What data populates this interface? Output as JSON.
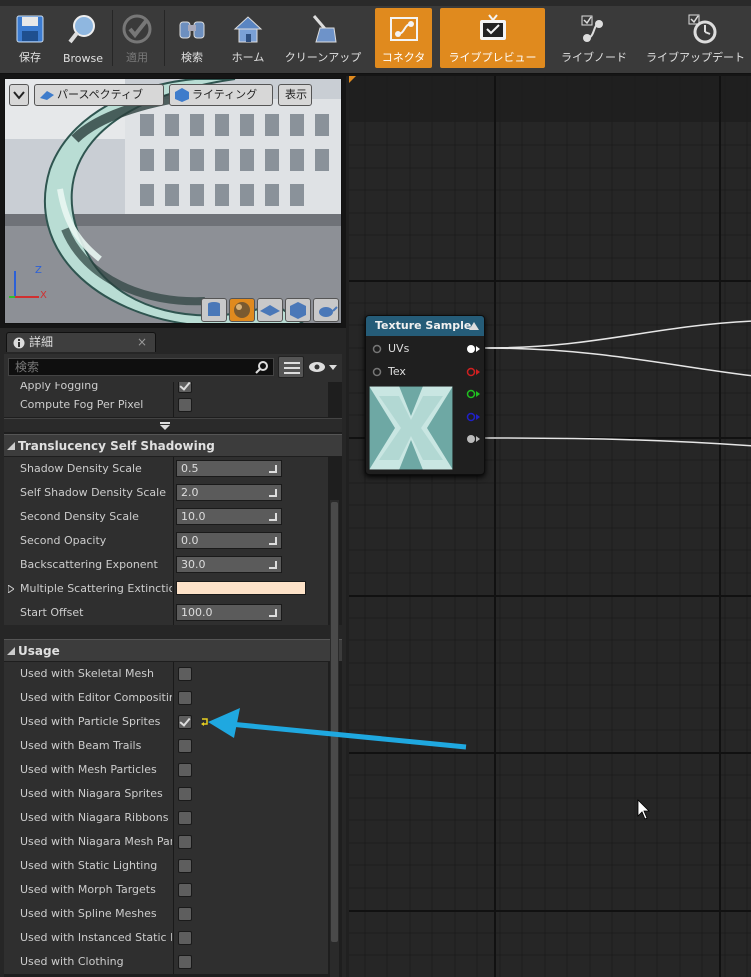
{
  "toolbar": {
    "buttons": [
      {
        "label": "保存",
        "icon": "save-icon"
      },
      {
        "label": "Browse",
        "icon": "browse-icon"
      },
      {
        "label": "適用",
        "icon": "apply-icon"
      },
      {
        "label": "検索",
        "icon": "search-icon"
      },
      {
        "label": "ホーム",
        "icon": "home-icon"
      },
      {
        "label": "クリーンアップ",
        "icon": "cleanup-icon"
      },
      {
        "label": "コネクタ",
        "icon": "connector-icon"
      },
      {
        "label": "ライブプレビュー",
        "icon": "live-preview-icon"
      },
      {
        "label": "ライブノード",
        "icon": "live-node-icon"
      },
      {
        "label": "ライブアップデート",
        "icon": "live-update-icon"
      }
    ]
  },
  "viewport": {
    "perspective_label": "パースペクティブ",
    "lighting_label": "ライティング",
    "show_label": "表示",
    "axis_z": "Z",
    "axis_x": "X"
  },
  "details": {
    "tab_label": "詳細",
    "search_placeholder": "検索",
    "top_rows": [
      {
        "name": "Apply Fogging",
        "checked": true
      },
      {
        "name": "Compute Fog Per Pixel",
        "checked": false
      }
    ],
    "translucency": {
      "title": "Translucency Self Shadowing",
      "rows": [
        {
          "name": "Shadow Density Scale",
          "value": "0.5"
        },
        {
          "name": "Self Shadow Density Scale",
          "value": "2.0"
        },
        {
          "name": "Second Density Scale",
          "value": "10.0"
        },
        {
          "name": "Second Opacity",
          "value": "0.0"
        },
        {
          "name": "Backscattering Exponent",
          "value": "30.0"
        }
      ],
      "multiple_scattering": {
        "name": "Multiple Scattering Extinction",
        "color": "#fde2c8"
      },
      "start_offset": {
        "name": "Start Offset",
        "value": "100.0"
      }
    },
    "usage": {
      "title": "Usage",
      "rows": [
        {
          "name": "Used with Skeletal Mesh",
          "checked": false
        },
        {
          "name": "Used with Editor Compositing",
          "checked": false
        },
        {
          "name": "Used with Particle Sprites",
          "checked": true
        },
        {
          "name": "Used with Beam Trails",
          "checked": false
        },
        {
          "name": "Used with Mesh Particles",
          "checked": false
        },
        {
          "name": "Used with Niagara Sprites",
          "checked": false
        },
        {
          "name": "Used with Niagara Ribbons",
          "checked": false
        },
        {
          "name": "Used with Niagara Mesh Particles",
          "checked": false
        },
        {
          "name": "Used with Static Lighting",
          "checked": false
        },
        {
          "name": "Used with Morph Targets",
          "checked": false
        },
        {
          "name": "Used with Spline Meshes",
          "checked": false
        },
        {
          "name": "Used with Instanced Static Meshes",
          "checked": false
        },
        {
          "name": "Used with Clothing",
          "checked": false
        }
      ]
    }
  },
  "node": {
    "title": "Texture Sample",
    "pin_uvs": "UVs",
    "pin_tex": "Tex"
  },
  "colors": {
    "accent_orange": "#e08a1e",
    "arrow_blue": "#1fa8e0",
    "node_header": "#255c78"
  }
}
